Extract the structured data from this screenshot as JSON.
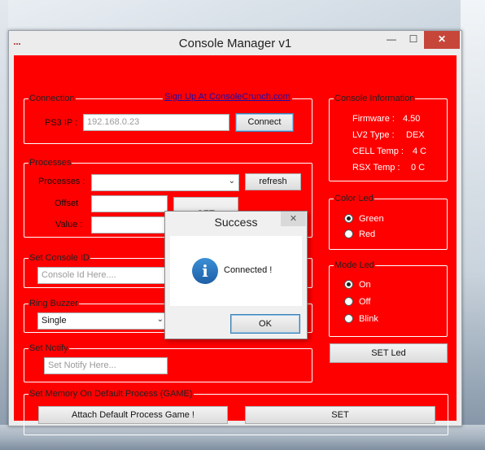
{
  "window": {
    "title": "Console Manager v1",
    "minimize_glyph": "—",
    "maximize_glyph": "☐",
    "close_glyph": "✕"
  },
  "connection": {
    "legend": "Connection",
    "signup_link": "Sign Up At ConsoleCrunch.com",
    "ip_label": "PS3 IP :",
    "ip_value": "192.168.0.23",
    "connect_label": "Connect"
  },
  "processes": {
    "legend": "Processes",
    "processes_label": "Processes :",
    "processes_value": "",
    "refresh_label": "refresh",
    "offset_label": "Offset",
    "offset_value": "",
    "value_label": "Value :",
    "value_value": "",
    "set_label": "SET"
  },
  "console_id": {
    "legend": "Set Console ID",
    "placeholder": "Console Id Here...."
  },
  "ring_buzzer": {
    "legend": "Ring Buzzer",
    "selected": "Single"
  },
  "notify": {
    "legend": "Set Notify",
    "placeholder": "Set Notify Here..."
  },
  "memory": {
    "legend": "Set Memory On Default Process (GAME)",
    "attach_label": "Attach Default Process Game !",
    "set_label": "SET"
  },
  "console_info": {
    "legend": "Console Information",
    "firmware_label": "Firmware :",
    "firmware_value": "4.50",
    "lv2_label": "LV2 Type :",
    "lv2_value": "DEX",
    "cell_label": "CELL Temp :",
    "cell_value": "4 C",
    "rsx_label": "RSX Temp :",
    "rsx_value": "0 C"
  },
  "color_led": {
    "legend": "Color Led",
    "options": [
      "Green",
      "Red"
    ],
    "selected": "Green"
  },
  "mode_led": {
    "legend": "Mode Led",
    "options": [
      "On",
      "Off",
      "Blink"
    ],
    "selected": "On",
    "set_label": "SET Led"
  },
  "dialog": {
    "title": "Success",
    "close_glyph": "✕",
    "icon_glyph": "i",
    "message": "Connected !",
    "ok_label": "OK"
  },
  "colors": {
    "client_bg": "#ff0000",
    "close_button": "#c7463a",
    "info_icon": "#2a78c2"
  }
}
